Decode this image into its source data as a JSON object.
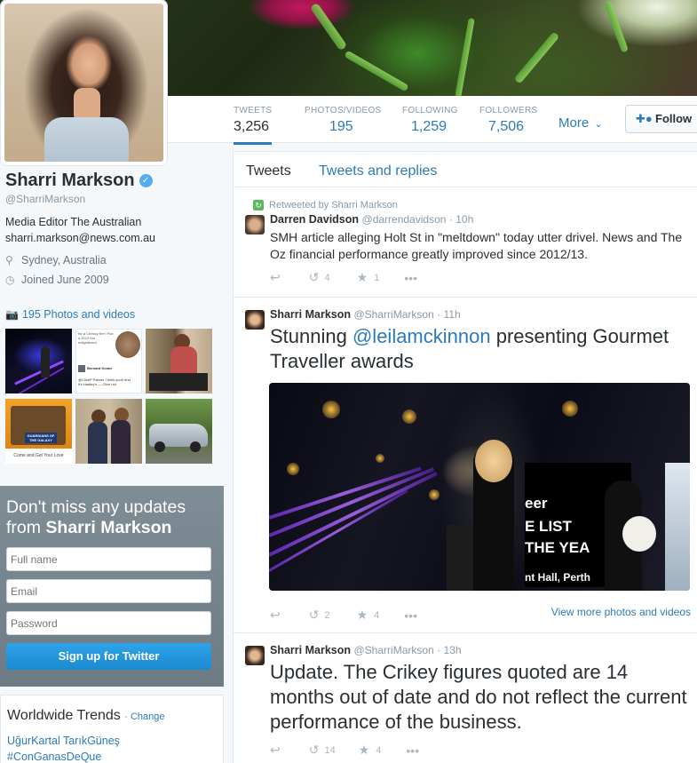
{
  "profile": {
    "name": "Sharri Markson",
    "handle": "@SharriMarkson",
    "bio": "Media Editor The Australian",
    "email": "sharri.markson@news.com.au",
    "location": "Sydney, Australia",
    "joined": "Joined June 2009",
    "photos_link": "195 Photos and videos"
  },
  "nav": {
    "tweets": {
      "label": "TWEETS",
      "value": "3,256"
    },
    "photos": {
      "label": "PHOTOS/VIDEOS",
      "value": "195"
    },
    "following": {
      "label": "FOLLOWING",
      "value": "1,259"
    },
    "followers": {
      "label": "FOLLOWERS",
      "value": "7,506"
    },
    "more": "More",
    "follow": "Follow"
  },
  "timeline": {
    "tab_tweets": "Tweets",
    "tab_replies": "Tweets and replies",
    "tweets": [
      {
        "retweet_context": "Retweeted by Sharri Markson",
        "name": "Darren Davidson",
        "handle": "@darrendavidson",
        "time": "· 10h",
        "text": "SMH article alleging Holt St in \"meltdown\" today utter drivel. News and The Oz financial performance greatly improved since 2012/13.",
        "retweets": "4",
        "favorites": "1"
      },
      {
        "name": "Sharri Markson",
        "handle": "@SharriMarkson",
        "time": "· 11h",
        "text_before": "Stunning ",
        "mention": "@leilamckinnon",
        "text_after": " presenting Gourmet Traveller awards",
        "media_text_1": "eer",
        "media_text_2": "E LIST",
        "media_text_3": "THE YEA",
        "media_text_4": "nt Hall, Perth",
        "retweets": "2",
        "favorites": "4",
        "view_more": "View more photos and videos"
      },
      {
        "name": "Sharri Markson",
        "handle": "@SharriMarkson",
        "time": "· 13h",
        "text": "Update. The Crikey figures quoted are 14 months out of date and do not reflect the current performance of the business.",
        "retweets": "14",
        "favorites": "4"
      }
    ]
  },
  "signup": {
    "heading_prefix": "Don't miss any updates from",
    "heading_name": "Sharri Markson",
    "fullname_placeholder": "Full name",
    "email_placeholder": "Email",
    "password_placeholder": "Password",
    "button": "Sign up for Twitter"
  },
  "trends": {
    "title": "Worldwide Trends",
    "change": "· Change",
    "items": [
      "UğurKartal TarıkGüneş",
      "#ConGanasDeQue"
    ]
  },
  "thumbs": {
    "t2_lines": [
      "for a Chrissy fire? Pub a 2012 too",
      "enlightened"
    ],
    "t2_name": "Bernard Keane",
    "t2_tweet": "@CliveP Palmer I think you'll find it's Hadley's — Clive not",
    "t4_logo": "GUARDIANS OF THE GALAXY",
    "t4_caption": "Come and Get Your Love"
  },
  "colors": {
    "accent": "#2b7bb9",
    "signup_bg": "#7f8d97",
    "verified": "#55acee"
  }
}
